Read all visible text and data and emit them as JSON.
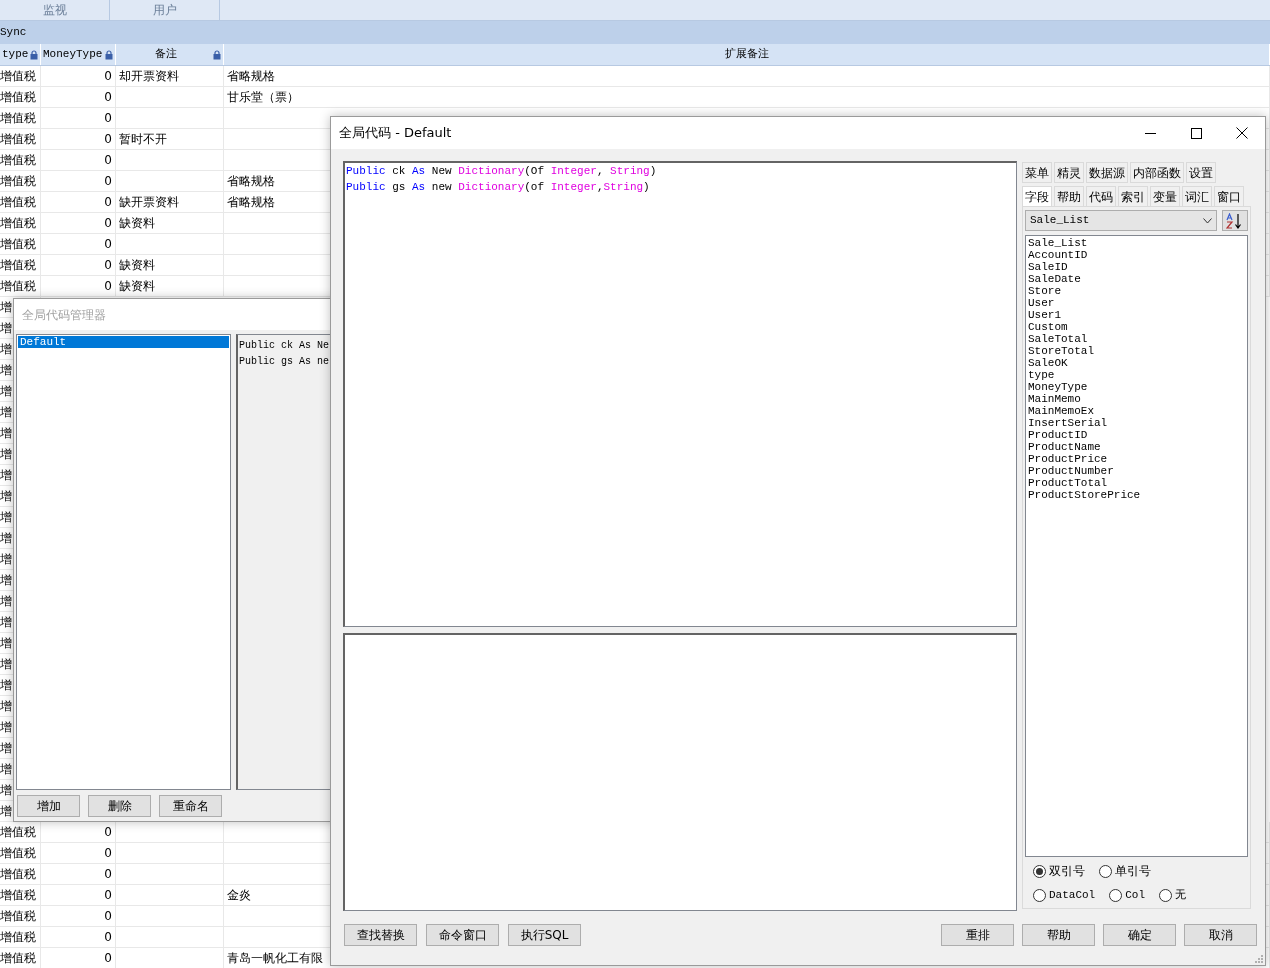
{
  "app": {
    "tabs": [
      {
        "label": "监视",
        "selected": false
      },
      {
        "label": "用户",
        "selected": false
      }
    ],
    "title": "Sync"
  },
  "table": {
    "columns": [
      {
        "label": "type",
        "locked": true
      },
      {
        "label": "MoneyType",
        "locked": true
      },
      {
        "label": "备注",
        "locked": true
      },
      {
        "label": "扩展备注",
        "locked": false
      }
    ],
    "rows": [
      {
        "type": "增值税",
        "money_type": "0",
        "memo": "却开票资料",
        "memo_ex": "省略规格"
      },
      {
        "type": "增值税",
        "money_type": "0",
        "memo_ex": "甘乐堂（票）"
      },
      {
        "type": "增值税",
        "money_type": "0"
      },
      {
        "type": "增值税",
        "money_type": "0",
        "memo": "暂时不开"
      },
      {
        "type": "增值税",
        "money_type": "0"
      },
      {
        "type": "增值税",
        "money_type": "0",
        "memo_ex": "省略规格"
      },
      {
        "type": "增值税",
        "money_type": "0",
        "memo": "缺开票资料",
        "memo_ex": "省略规格"
      },
      {
        "type": "增值税",
        "money_type": "0",
        "memo": "缺资料"
      },
      {
        "type": "增值税",
        "money_type": "0"
      },
      {
        "type": "增值税",
        "money_type": "0",
        "memo": "缺资料"
      },
      {
        "type": "增值税",
        "money_type": "0",
        "memo": "缺资料"
      },
      {
        "type": "增"
      },
      {
        "type": "增"
      },
      {
        "type": "增"
      },
      {
        "type": "增"
      },
      {
        "type": "增"
      },
      {
        "type": "增"
      },
      {
        "type": "增"
      },
      {
        "type": "增"
      },
      {
        "type": "增"
      },
      {
        "type": "增"
      },
      {
        "type": "增"
      },
      {
        "type": "增"
      },
      {
        "type": "增"
      },
      {
        "type": "增"
      },
      {
        "type": "增"
      },
      {
        "type": "增"
      },
      {
        "type": "增"
      },
      {
        "type": "增"
      },
      {
        "type": "增"
      },
      {
        "type": "增"
      },
      {
        "type": "增"
      },
      {
        "type": "增"
      },
      {
        "type": "增"
      },
      {
        "type": "增"
      },
      {
        "type": "增"
      },
      {
        "type": "增值税",
        "money_type": "0"
      },
      {
        "type": "增值税",
        "money_type": "0"
      },
      {
        "type": "增值税",
        "money_type": "0"
      },
      {
        "type": "增值税",
        "money_type": "0",
        "memo_ex": "金炎"
      },
      {
        "type": "增值税",
        "money_type": "0"
      },
      {
        "type": "增值税",
        "money_type": "0"
      },
      {
        "type": "增值税",
        "money_type": "0",
        "memo_ex": "青岛一帆化工有限"
      }
    ]
  },
  "manager_dialog": {
    "title": "全局代码管理器",
    "active": false,
    "items": [
      {
        "label": "Default",
        "selected": true
      }
    ],
    "preview_lines": [
      "Public ck As Ne",
      "Public gs As ne"
    ],
    "buttons": [
      "增加",
      "删除",
      "重命名"
    ]
  },
  "code_dialog": {
    "title": "全局代码 - Default",
    "code_lines": [
      [
        {
          "kind": "keyword",
          "text": "Public"
        },
        {
          "kind": "plain",
          "text": " ck "
        },
        {
          "kind": "keyword",
          "text": "As"
        },
        {
          "kind": "plain",
          "text": " New "
        },
        {
          "kind": "type",
          "text": "Dictionary"
        },
        {
          "kind": "plain",
          "text": "(Of "
        },
        {
          "kind": "type",
          "text": "Integer"
        },
        {
          "kind": "plain",
          "text": ", "
        },
        {
          "kind": "type",
          "text": "String"
        },
        {
          "kind": "plain",
          "text": ")"
        }
      ],
      [
        {
          "kind": "keyword",
          "text": "Public"
        },
        {
          "kind": "plain",
          "text": " gs "
        },
        {
          "kind": "keyword",
          "text": "As"
        },
        {
          "kind": "plain",
          "text": " new "
        },
        {
          "kind": "type",
          "text": "Dictionary"
        },
        {
          "kind": "plain",
          "text": "(of "
        },
        {
          "kind": "type",
          "text": "Integer"
        },
        {
          "kind": "plain",
          "text": ","
        },
        {
          "kind": "type",
          "text": "String"
        },
        {
          "kind": "plain",
          "text": ")"
        }
      ]
    ],
    "tabs_row_1": [
      {
        "label": "菜单",
        "selected": false
      },
      {
        "label": "精灵",
        "selected": false
      },
      {
        "label": "数据源",
        "selected": false
      },
      {
        "label": "内部函数",
        "selected": false
      },
      {
        "label": "设置",
        "selected": false
      }
    ],
    "tabs_row_2": [
      {
        "label": "字段",
        "selected": true
      },
      {
        "label": "帮助",
        "selected": false
      },
      {
        "label": "代码",
        "selected": false
      },
      {
        "label": "索引",
        "selected": false
      },
      {
        "label": "变量",
        "selected": false
      },
      {
        "label": "词汇",
        "selected": false
      },
      {
        "label": "窗口",
        "selected": false
      }
    ],
    "table_select": "Sale_List",
    "fields": [
      "Sale_List",
      "AccountID",
      "SaleID",
      "SaleDate",
      "Store",
      "User",
      "User1",
      "Custom",
      "SaleTotal",
      "StoreTotal",
      "SaleOK",
      "type",
      "MoneyType",
      "MainMemo",
      "MainMemoEx",
      "InsertSerial",
      "ProductID",
      "ProductName",
      "ProductPrice",
      "ProductNumber",
      "ProductTotal",
      "ProductStorePrice"
    ],
    "quote_options": [
      {
        "label": "双引号",
        "selected": true
      },
      {
        "label": "单引号",
        "selected": false
      }
    ],
    "column_options": [
      {
        "label": "DataCol",
        "selected": false
      },
      {
        "label": "Col",
        "selected": false
      },
      {
        "label": "无",
        "selected": false
      }
    ],
    "left_buttons": [
      "查找替换",
      "命令窗口",
      "执行SQL"
    ],
    "right_buttons": [
      "重排",
      "帮助",
      "确定",
      "取消"
    ]
  }
}
